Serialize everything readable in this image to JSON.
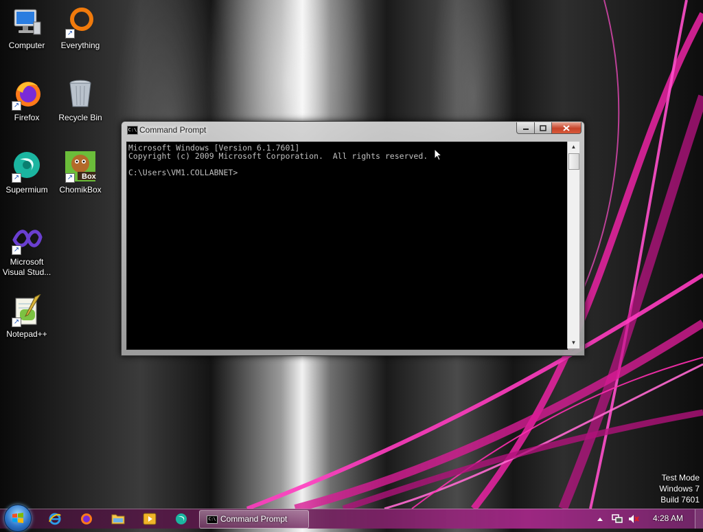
{
  "desktop": {
    "icons": [
      {
        "label": "Computer",
        "icon": "computer-icon"
      },
      {
        "label": "Everything",
        "icon": "everything-icon"
      },
      {
        "label": "Firefox",
        "icon": "firefox-icon"
      },
      {
        "label": "Recycle Bin",
        "icon": "recycle-bin-icon"
      },
      {
        "label": "Supermium",
        "icon": "supermium-icon"
      },
      {
        "label": "ChomikBox",
        "icon": "chomikbox-icon",
        "badge": "Box"
      },
      {
        "label": "Microsoft Visual Stud...",
        "icon": "visual-studio-icon"
      },
      {
        "label": "Notepad++",
        "icon": "notepadpp-icon"
      }
    ]
  },
  "cmd_window": {
    "title": "Command Prompt",
    "icon_text": "C:\\",
    "buttons": {
      "minimize": "minimize",
      "maximize": "maximize",
      "close": "close"
    },
    "console_lines": [
      "Microsoft Windows [Version 6.1.7601]",
      "Copyright (c) 2009 Microsoft Corporation.  All rights reserved.",
      "",
      "C:\\Users\\VM1.COLLABNET>"
    ]
  },
  "watermark": {
    "line1": "Test Mode",
    "line2": "Windows 7",
    "line3": "Build 7601"
  },
  "taskbar": {
    "pinned": [
      "internet-explorer-icon",
      "firefox-icon",
      "explorer-folder-icon",
      "media-player-icon",
      "supermium-icon"
    ],
    "active_task": {
      "label": "Command Prompt",
      "icon_text": "C:\\"
    },
    "tray_icons": [
      "show-hidden-icons-arrow",
      "network-icon",
      "volume-muted-icon"
    ],
    "clock": "4:28 AM"
  },
  "colors": {
    "console_bg": "#000000",
    "console_fg": "#c0c0c0",
    "accent_pink": "#e0229c",
    "close_button": "#c7442a"
  }
}
